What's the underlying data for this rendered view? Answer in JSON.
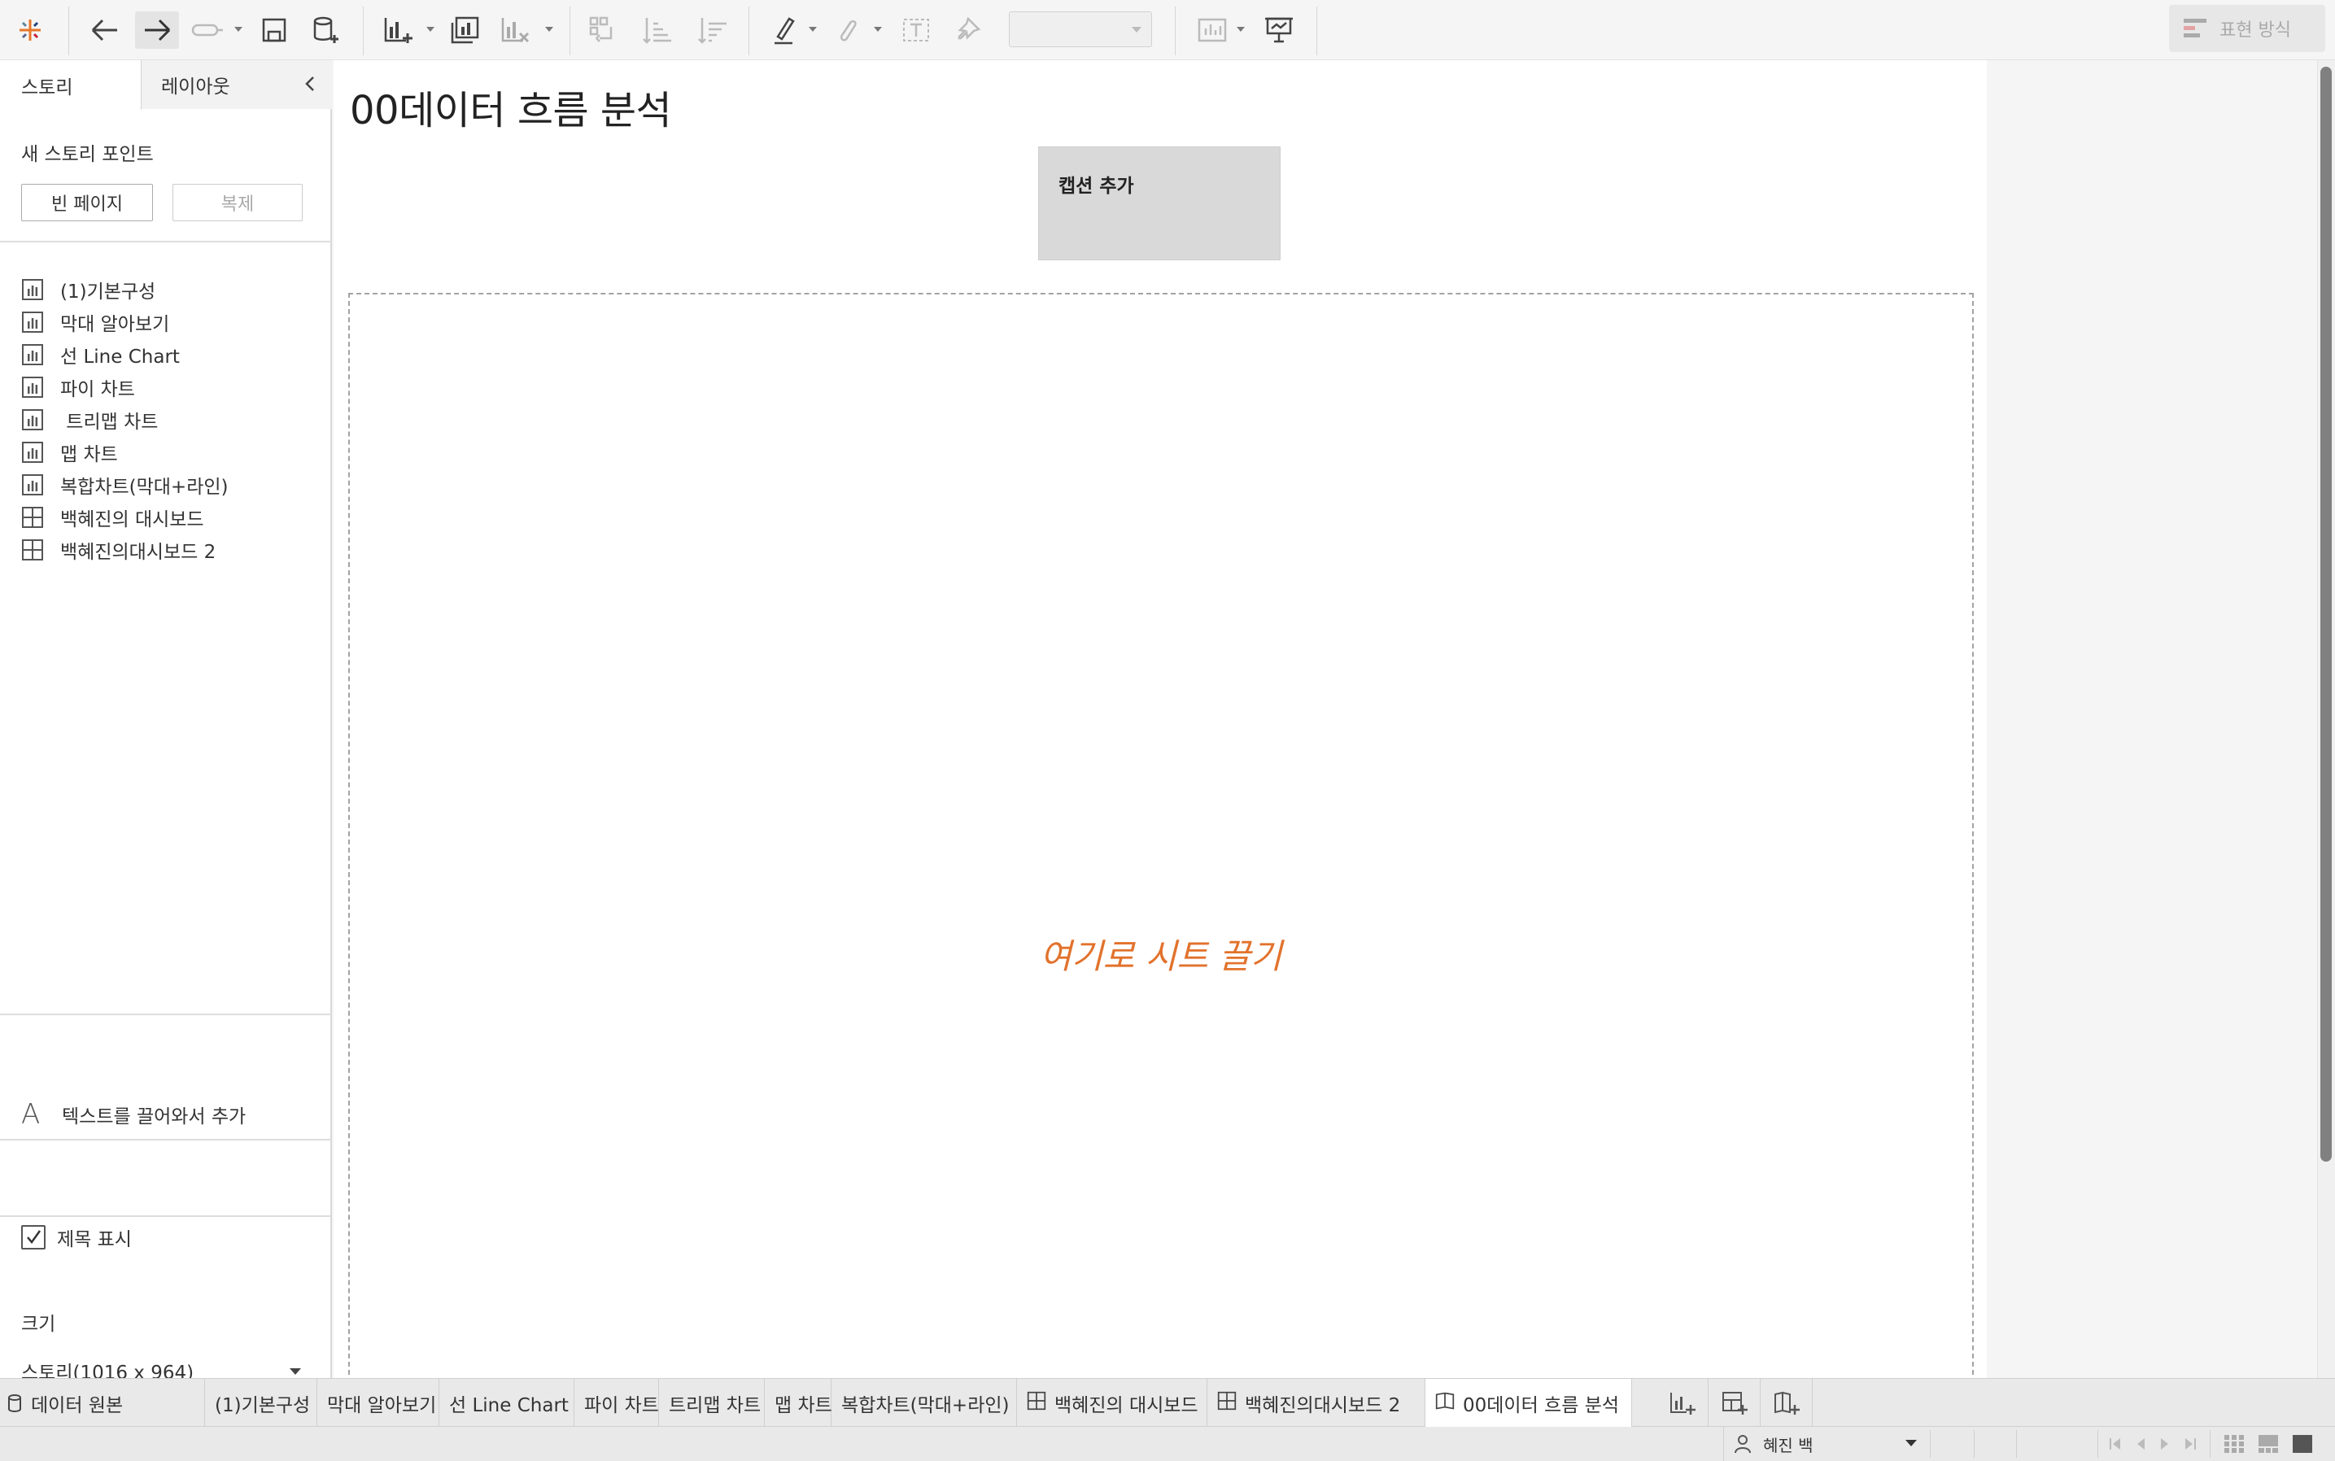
{
  "toolbar": {
    "show_me_label": "표현 방식",
    "icons": [
      "tableau-logo-icon",
      "back-icon",
      "forward-icon",
      "redo-icon",
      "save-icon",
      "new-datasource-icon",
      "new-worksheet-icon",
      "duplicate-sheet-icon",
      "clear-sheet-icon",
      "swap-icon",
      "sort-ascending-icon",
      "sort-descending-icon",
      "highlight-icon",
      "group-icon",
      "label-icon",
      "pin-icon",
      "show-cards-icon",
      "presentation-icon"
    ]
  },
  "left_pane": {
    "tabs": {
      "story": "스토리",
      "layout": "레이아웃"
    },
    "new_story_point_label": "새 스토리 포인트",
    "blank_page_button": "빈 페이지",
    "duplicate_button": "복제",
    "sheets": [
      {
        "label": "(1)기본구성",
        "icon": "worksheet-icon"
      },
      {
        "label": "막대 알아보기",
        "icon": "worksheet-icon"
      },
      {
        "label": "선 Line Chart",
        "icon": "worksheet-icon"
      },
      {
        "label": "파이 차트",
        "icon": "worksheet-icon"
      },
      {
        "label": " 트리맵 차트",
        "icon": "worksheet-icon"
      },
      {
        "label": "맵 차트",
        "icon": "worksheet-icon"
      },
      {
        "label": "복합차트(막대+라인)",
        "icon": "worksheet-icon"
      },
      {
        "label": "백혜진의 대시보드",
        "icon": "dashboard-icon"
      },
      {
        "label": "백혜진의대시보드 2",
        "icon": "dashboard-icon"
      }
    ],
    "drag_text_label": "텍스트를 끌어와서 추가",
    "show_title_label": "제목 표시",
    "show_title_checked": true,
    "size_label": "크기",
    "size_value": "스토리(1016 x 964)"
  },
  "canvas": {
    "title": "00데이터 흐름 분석",
    "caption_placeholder": "캡션 추가",
    "drop_hint": "여기로 시트 끌기",
    "drop_hint_color": "#e2722c"
  },
  "tabs": {
    "data_source": "데이터 원본",
    "sheets": [
      {
        "label": "(1)기본구성",
        "icon": ""
      },
      {
        "label": "막대 알아보기",
        "icon": ""
      },
      {
        "label": "선 Line Chart",
        "icon": ""
      },
      {
        "label": "파이 차트",
        "icon": ""
      },
      {
        "label": "트리맵 차트",
        "icon": ""
      },
      {
        "label": "맵 차트",
        "icon": ""
      },
      {
        "label": "복합차트(막대+라인)",
        "icon": ""
      },
      {
        "label": "백혜진의 대시보드",
        "icon": "dashboard-icon"
      },
      {
        "label": "백혜진의대시보드 2",
        "icon": "dashboard-icon"
      },
      {
        "label": "00데이터 흐름 분석",
        "icon": "story-icon",
        "active": true
      }
    ]
  },
  "status": {
    "user": "혜진 백"
  }
}
